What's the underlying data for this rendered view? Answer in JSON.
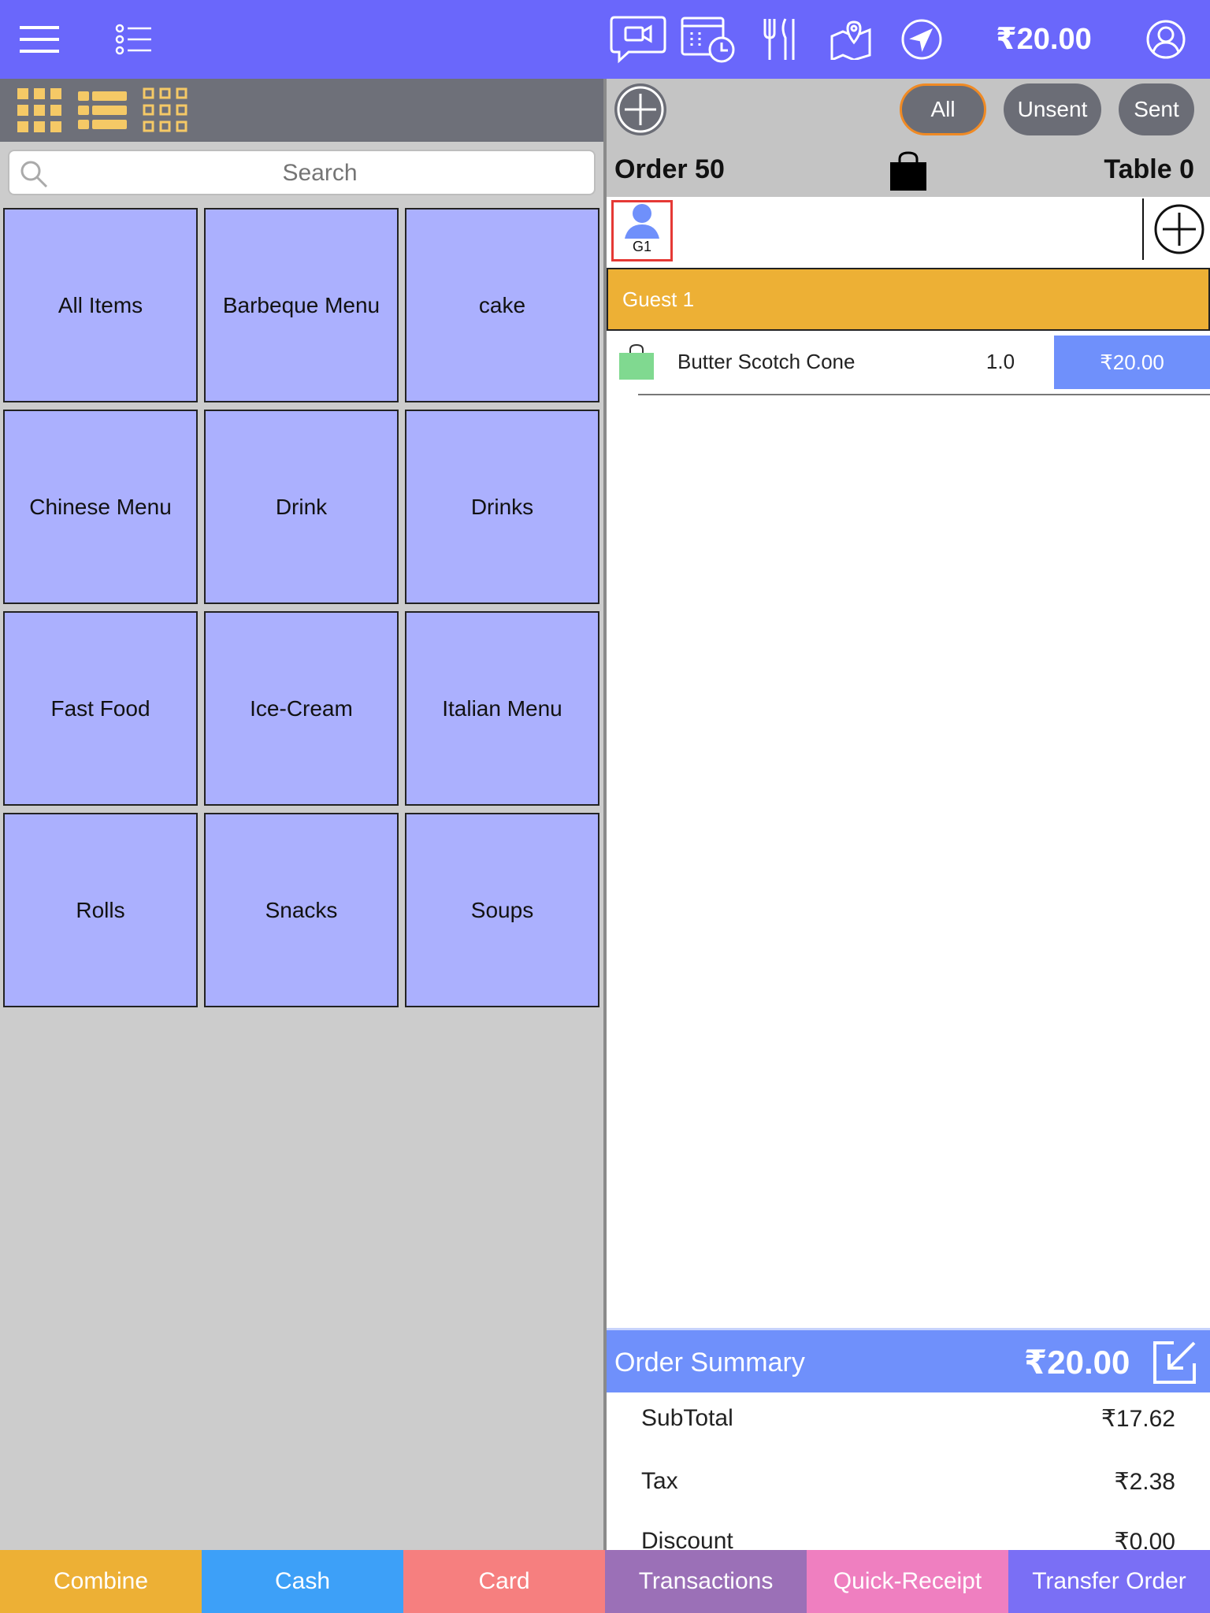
{
  "header": {
    "total": "₹20.00",
    "icons": [
      "menu-icon",
      "list-icon",
      "video-chat-icon",
      "calendar-clock-icon",
      "restaurant-icon",
      "map-location-icon",
      "navigation-icon",
      "user-profile-icon"
    ],
    "color": "#6a67fb"
  },
  "left": {
    "view_icons": [
      "grid-view-icon",
      "list-view-icon",
      "small-grid-view-icon"
    ],
    "search": {
      "placeholder": "Search",
      "value": ""
    },
    "categories": [
      "All Items",
      "Barbeque Menu",
      "cake",
      "Chinese Menu",
      "Drink",
      "Drinks",
      "Fast Food",
      "Ice-Cream",
      "Italian Menu",
      "Rolls",
      "Snacks",
      "Soups"
    ],
    "tile_color": "#abb0fe"
  },
  "order": {
    "filters": [
      "All",
      "Unsent",
      "Sent"
    ],
    "active_filter": "All",
    "number": "Order 50",
    "table": "Table 0",
    "guest_chip": "G1",
    "guest_label": "Guest 1",
    "items": [
      {
        "name": "Butter Scotch Cone",
        "qty": "1.0",
        "price": "₹20.00"
      }
    ]
  },
  "summary": {
    "title": "Order Summary",
    "total": "₹20.00",
    "rows": [
      {
        "label": "SubTotal",
        "value": "₹17.62"
      },
      {
        "label": "Tax",
        "value": "₹2.38"
      },
      {
        "label": "Discount",
        "value": "₹0.00"
      }
    ]
  },
  "actions": [
    {
      "label": "Combine",
      "color": "#edb035"
    },
    {
      "label": "Cash",
      "color": "#3da0f8"
    },
    {
      "label": "Card",
      "color": "#f67f7f"
    },
    {
      "label": "Transactions",
      "color": "#9b70b7"
    },
    {
      "label": "Quick-Receipt",
      "color": "#ef7fc0"
    },
    {
      "label": "Transfer Order",
      "color": "#7a6ff5"
    }
  ]
}
